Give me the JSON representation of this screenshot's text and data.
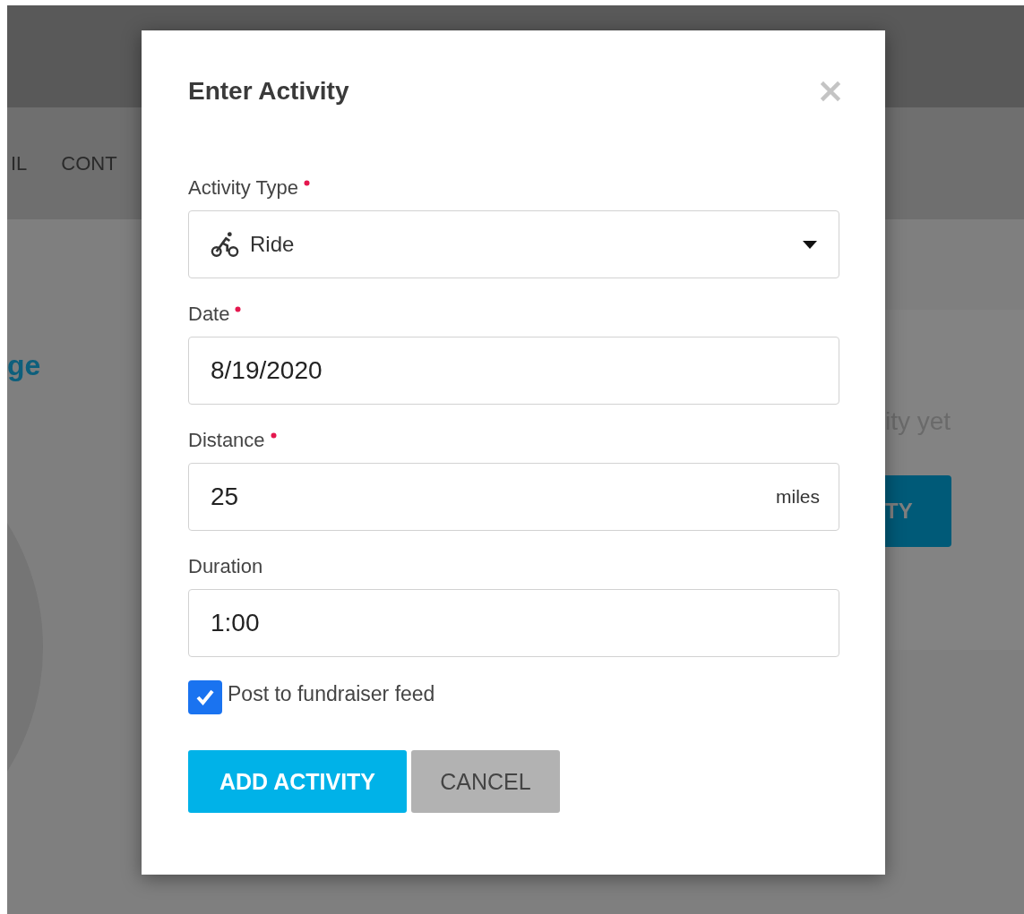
{
  "background": {
    "nav_items": [
      "IL",
      "CONT"
    ],
    "heading": "ge",
    "message": "ity yet",
    "button": "TY"
  },
  "dialog": {
    "title": "Enter Activity",
    "fields": [
      {
        "kind": "select",
        "label": "Activity Type",
        "required": true,
        "value": "Ride"
      },
      {
        "kind": "text",
        "label": "Date",
        "required": true,
        "value": "8/19/2020"
      },
      {
        "kind": "unit",
        "label": "Distance",
        "required": true,
        "value": "25",
        "unit": "miles"
      },
      {
        "kind": "text",
        "label": "Duration",
        "required": false,
        "value": "1:00"
      }
    ],
    "checkbox": {
      "label": "Post to fundraiser feed",
      "checked": true
    },
    "buttons": [
      {
        "label": "ADD ACTIVITY",
        "kind": "primary"
      },
      {
        "label": "CANCEL",
        "kind": "secondary"
      }
    ]
  }
}
